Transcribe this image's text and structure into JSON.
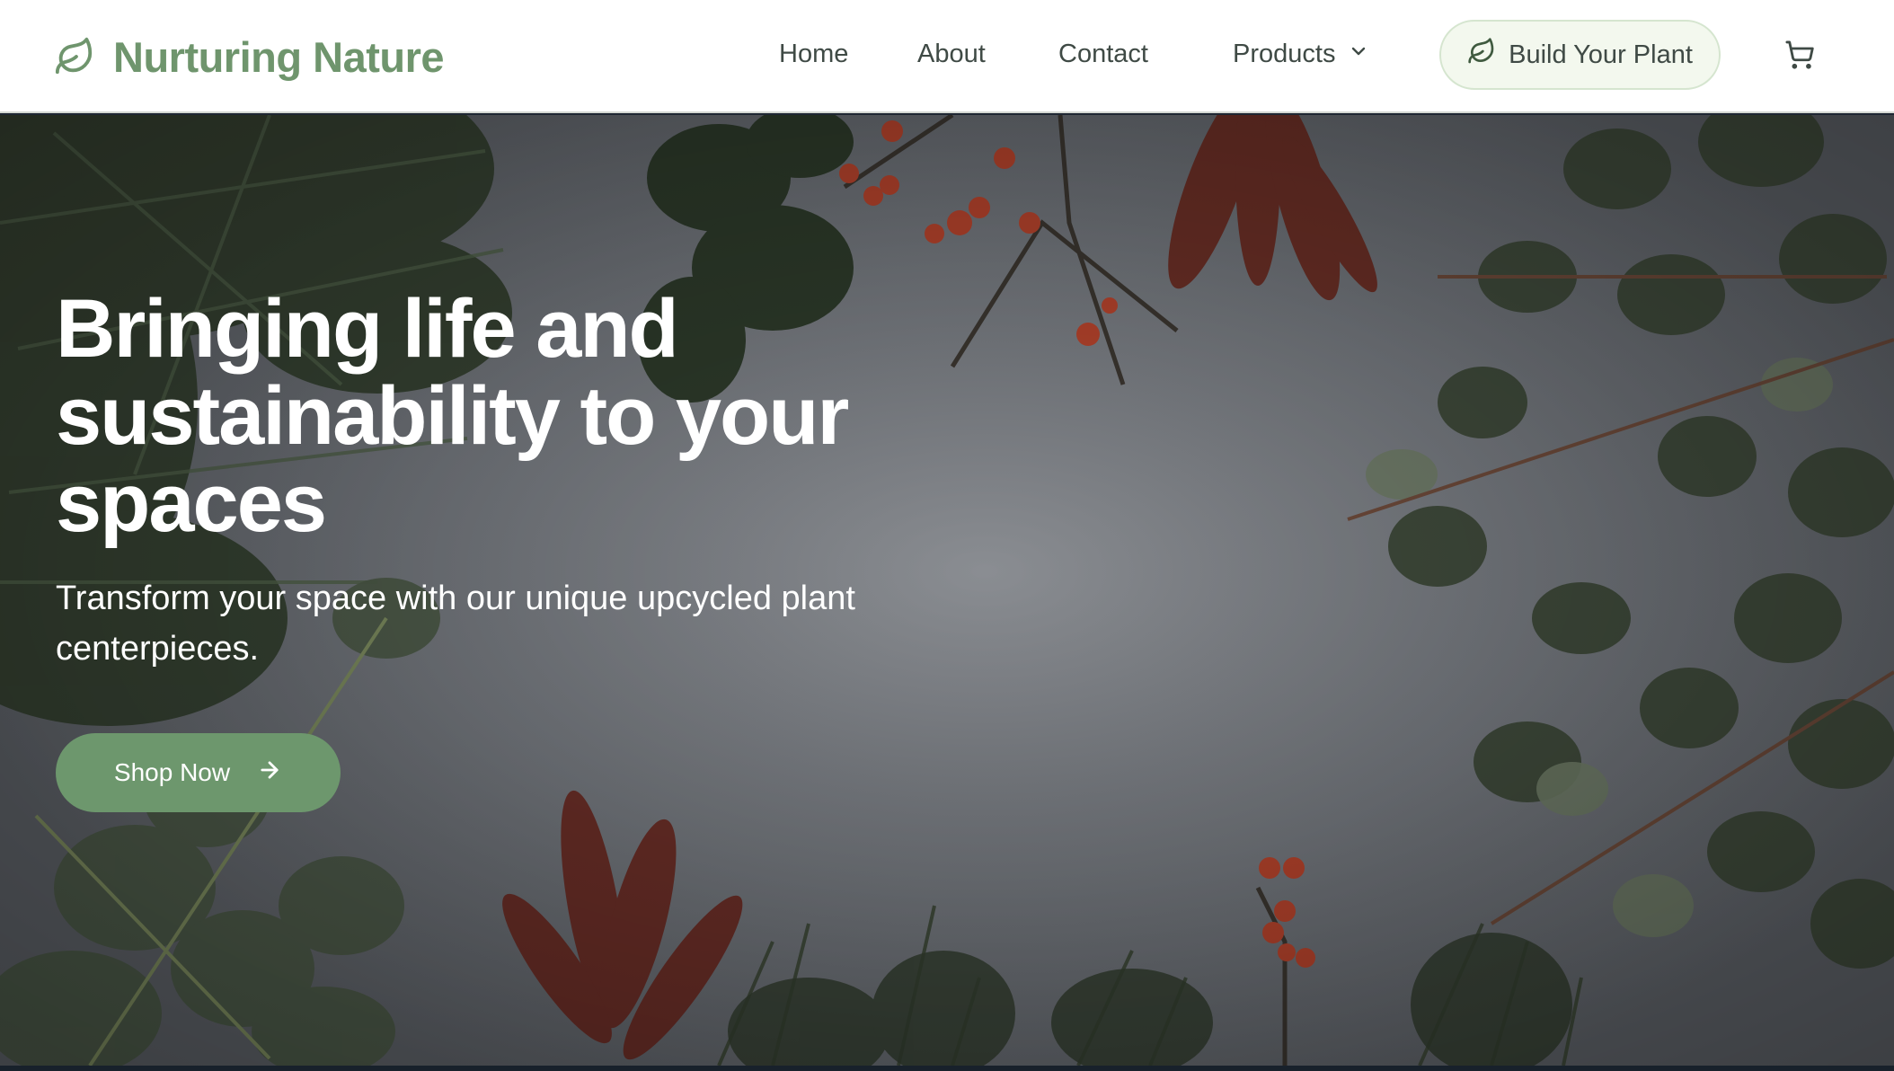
{
  "header": {
    "brand_name": "Nurturing Nature",
    "brand_icon": "leaf-icon",
    "nav": {
      "home": "Home",
      "about": "About",
      "contact": "Contact",
      "products": "Products"
    },
    "build_button": "Build Your Plant",
    "cart_icon": "cart-icon"
  },
  "hero": {
    "title": "Bringing life and sustainability to your spaces",
    "subtitle": "Transform your space with our unique upcycled plant centerpieces.",
    "cta_label": "Shop Now"
  },
  "colors": {
    "brand": "#6f956d",
    "button": "#6d976d",
    "build_button_bg": "#f3f8ee"
  }
}
